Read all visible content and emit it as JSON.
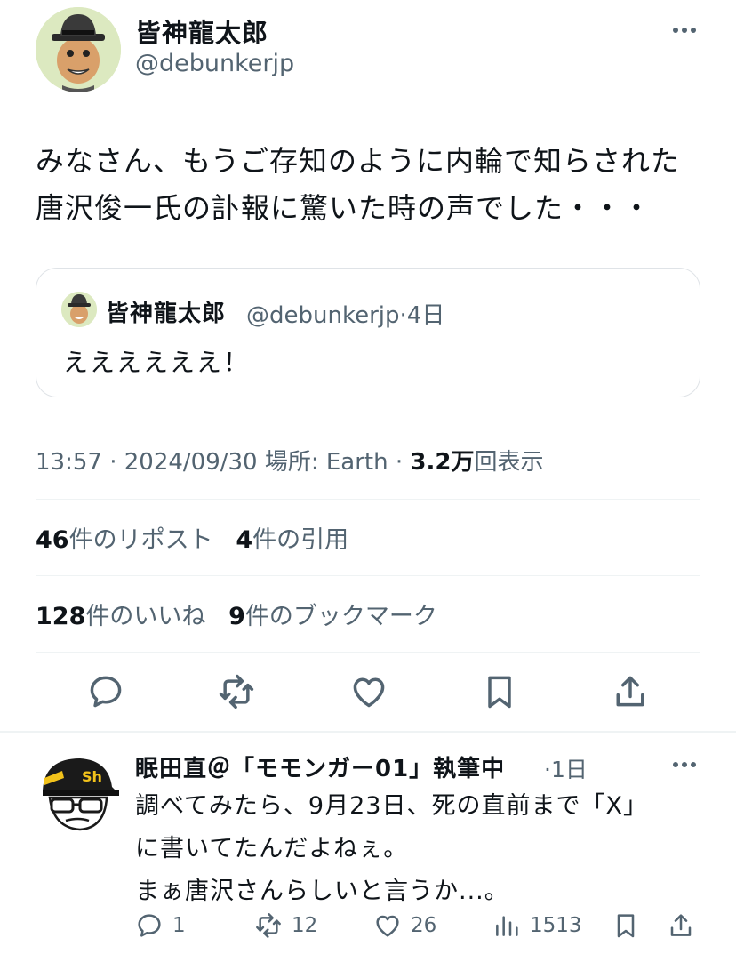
{
  "tweet": {
    "author_name": "皆神龍太郎",
    "author_handle": "@debunkerjp",
    "text_line1": "みなさん、もうご存知のように内輪で知らされた",
    "text_line2": "唐沢俊一氏の訃報に驚いた時の声でした・・・",
    "quote": {
      "author_name": "皆神龍太郎",
      "author_handle": "@debunkerjp",
      "time": "4日",
      "text": "ええええええ！"
    },
    "meta": {
      "time": "13:57",
      "date": "2024/09/30",
      "location_label": "場所: Earth",
      "views_count": "3.2万",
      "views_label": "回表示"
    },
    "stats": {
      "reposts_count": "46",
      "reposts_label": "件のリポスト",
      "quotes_count": "4",
      "quotes_label": "件の引用",
      "likes_count": "128",
      "likes_label": "件のいいね",
      "bookmarks_count": "9",
      "bookmarks_label": "件のブックマーク"
    }
  },
  "reply": {
    "author_name": "眠田直＠「モモンガー01」執筆中",
    "time": "1日",
    "text_line1": "調べてみたら、9月23日、死の直前まで「X」",
    "text_line2": "に書いてたんだよねぇ。",
    "text_line3": "まぁ唐沢さんらしいと言うか...。",
    "actions": {
      "replies": "1",
      "reposts": "12",
      "likes": "26",
      "views": "1513"
    }
  },
  "icons": {
    "main_actions": [
      "reply-icon",
      "repost-icon",
      "like-icon",
      "bookmark-icon",
      "share-icon"
    ],
    "more": "more-dots-icon"
  },
  "colors": {
    "text_primary": "#0f1419",
    "text_secondary": "#536471",
    "divider": "#eff3f4"
  }
}
